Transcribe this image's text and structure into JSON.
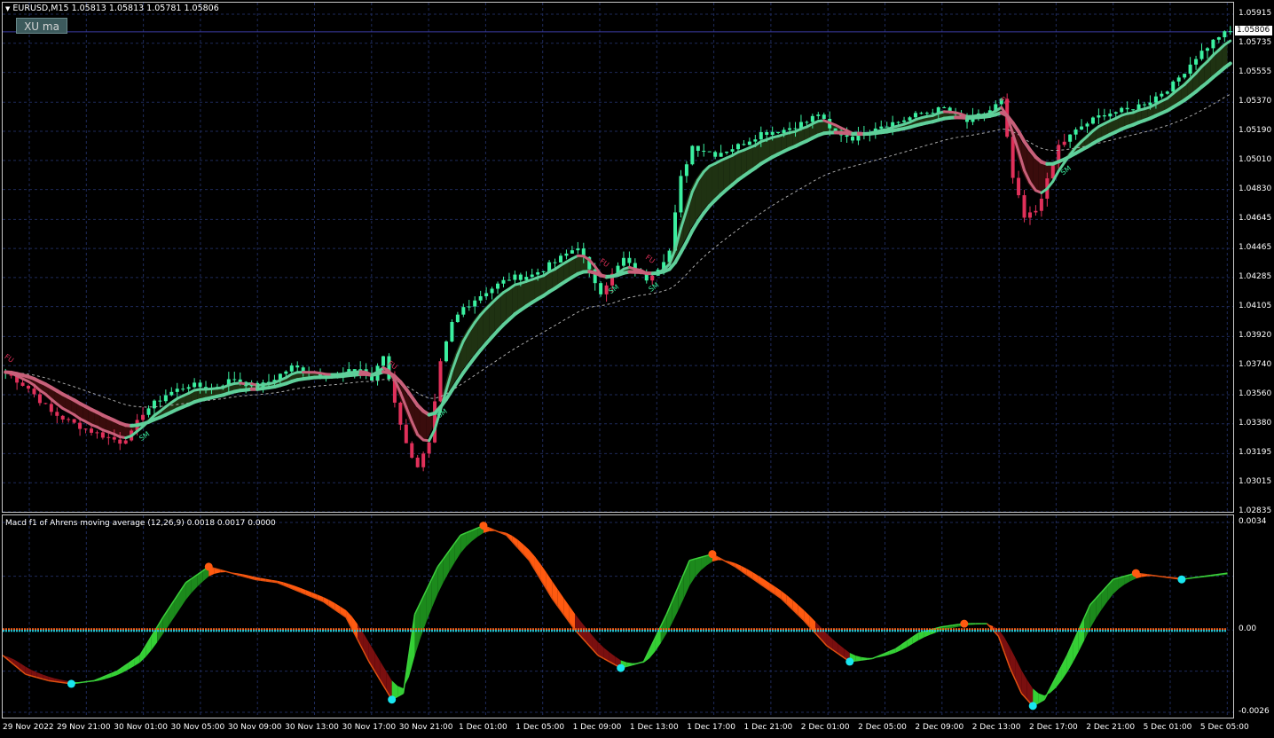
{
  "header": {
    "symbol_line": "EURUSD,M15  1.05813 1.05813 1.05781 1.05806",
    "indicator_button": "XU ma",
    "current_price": "1.05806"
  },
  "main_axis": {
    "labels": [
      "1.05915",
      "1.05735",
      "1.05555",
      "1.05370",
      "1.05190",
      "1.05010",
      "1.04830",
      "1.04645",
      "1.04465",
      "1.04285",
      "1.04105",
      "1.03920",
      "1.03740",
      "1.03560",
      "1.03380",
      "1.03195",
      "1.03015",
      "1.02835"
    ]
  },
  "sub_window": {
    "title": "Macd f1 of Ahrens moving average (12,26,9) 0.0018 0.0017 0.0000",
    "axis_labels": [
      "0.0034",
      "0.00",
      "-0.0026"
    ]
  },
  "time_axis": {
    "labels": [
      "29 Nov 2022",
      "29 Nov 21:00",
      "30 Nov 01:00",
      "30 Nov 05:00",
      "30 Nov 09:00",
      "30 Nov 13:00",
      "30 Nov 17:00",
      "30 Nov 21:00",
      "1 Dec 01:00",
      "1 Dec 05:00",
      "1 Dec 09:00",
      "1 Dec 13:00",
      "1 Dec 17:00",
      "1 Dec 21:00",
      "2 Dec 01:00",
      "2 Dec 05:00",
      "2 Dec 09:00",
      "2 Dec 13:00",
      "2 Dec 17:00",
      "2 Dec 21:00",
      "5 Dec 01:00",
      "5 Dec 05:00"
    ]
  },
  "signals": {
    "down_label": "FU",
    "up_label": "SM"
  },
  "chart_data": {
    "type": "line",
    "symbol": "EURUSD",
    "timeframe": "M15",
    "ohlc_last": {
      "open": 1.05813,
      "high": 1.05813,
      "low": 1.05781,
      "close": 1.05806
    },
    "price_range": [
      1.02835,
      1.05915
    ],
    "close_path": [
      [
        0,
        1.037
      ],
      [
        4,
        1.036
      ],
      [
        8,
        1.0345
      ],
      [
        12,
        1.0338
      ],
      [
        16,
        1.0332
      ],
      [
        20,
        1.0327
      ],
      [
        22,
        1.0332
      ],
      [
        24,
        1.0345
      ],
      [
        28,
        1.0356
      ],
      [
        32,
        1.0362
      ],
      [
        36,
        1.036
      ],
      [
        40,
        1.0366
      ],
      [
        44,
        1.036
      ],
      [
        46,
        1.0364
      ],
      [
        50,
        1.0373
      ],
      [
        54,
        1.037
      ],
      [
        58,
        1.0368
      ],
      [
        62,
        1.0372
      ],
      [
        64,
        1.0365
      ],
      [
        66,
        1.038
      ],
      [
        68,
        1.0352
      ],
      [
        70,
        1.0325
      ],
      [
        72,
        1.0312
      ],
      [
        74,
        1.0325
      ],
      [
        75,
        1.035
      ],
      [
        76,
        1.0375
      ],
      [
        78,
        1.04
      ],
      [
        80,
        1.041
      ],
      [
        84,
        1.042
      ],
      [
        88,
        1.0428
      ],
      [
        92,
        1.043
      ],
      [
        96,
        1.0438
      ],
      [
        100,
        1.0448
      ],
      [
        102,
        1.0432
      ],
      [
        104,
        1.042
      ],
      [
        106,
        1.043
      ],
      [
        108,
        1.044
      ],
      [
        110,
        1.0432
      ],
      [
        112,
        1.0428
      ],
      [
        114,
        1.0435
      ],
      [
        116,
        1.0445
      ],
      [
        118,
        1.049
      ],
      [
        120,
        1.051
      ],
      [
        124,
        1.0505
      ],
      [
        128,
        1.051
      ],
      [
        132,
        1.0518
      ],
      [
        136,
        1.052
      ],
      [
        140,
        1.0525
      ],
      [
        142,
        1.053
      ],
      [
        144,
        1.052
      ],
      [
        148,
        1.0515
      ],
      [
        152,
        1.0522
      ],
      [
        156,
        1.0525
      ],
      [
        160,
        1.053
      ],
      [
        164,
        1.0533
      ],
      [
        166,
        1.0528
      ],
      [
        168,
        1.0525
      ],
      [
        172,
        1.0532
      ],
      [
        174,
        1.0538
      ],
      [
        176,
        1.049
      ],
      [
        178,
        1.0465
      ],
      [
        180,
        1.047
      ],
      [
        182,
        1.0488
      ],
      [
        184,
        1.051
      ],
      [
        188,
        1.0522
      ],
      [
        192,
        1.053
      ],
      [
        196,
        1.0532
      ],
      [
        200,
        1.0538
      ],
      [
        204,
        1.0548
      ],
      [
        208,
        1.0565
      ],
      [
        212,
        1.0578
      ],
      [
        214,
        1.05806
      ]
    ],
    "macd_path": [
      [
        0,
        -0.0008
      ],
      [
        4,
        -0.0014
      ],
      [
        8,
        -0.0016
      ],
      [
        12,
        -0.0017
      ],
      [
        16,
        -0.0016
      ],
      [
        20,
        -0.0013
      ],
      [
        24,
        -0.0008
      ],
      [
        28,
        0.0004
      ],
      [
        32,
        0.0015
      ],
      [
        36,
        0.002
      ],
      [
        40,
        0.0018
      ],
      [
        44,
        0.0016
      ],
      [
        48,
        0.0015
      ],
      [
        52,
        0.0012
      ],
      [
        56,
        0.0009
      ],
      [
        60,
        0.0004
      ],
      [
        64,
        -0.001
      ],
      [
        68,
        -0.0022
      ],
      [
        70,
        -0.002
      ],
      [
        72,
        0.0005
      ],
      [
        76,
        0.002
      ],
      [
        80,
        0.003
      ],
      [
        84,
        0.0033
      ],
      [
        88,
        0.003
      ],
      [
        92,
        0.0022
      ],
      [
        96,
        0.001
      ],
      [
        100,
        0.0
      ],
      [
        104,
        -0.0008
      ],
      [
        108,
        -0.0012
      ],
      [
        112,
        -0.001
      ],
      [
        116,
        0.0005
      ],
      [
        120,
        0.0022
      ],
      [
        124,
        0.0024
      ],
      [
        128,
        0.002
      ],
      [
        132,
        0.0015
      ],
      [
        136,
        0.001
      ],
      [
        140,
        0.0003
      ],
      [
        144,
        -0.0005
      ],
      [
        148,
        -0.001
      ],
      [
        152,
        -0.0009
      ],
      [
        156,
        -0.0006
      ],
      [
        160,
        -0.0001
      ],
      [
        164,
        0.0001
      ],
      [
        168,
        0.0002
      ],
      [
        172,
        0.0002
      ],
      [
        174,
        -0.0002
      ],
      [
        176,
        -0.0012
      ],
      [
        178,
        -0.002
      ],
      [
        180,
        -0.0024
      ],
      [
        182,
        -0.0022
      ],
      [
        186,
        -0.0008
      ],
      [
        190,
        0.0008
      ],
      [
        194,
        0.0016
      ],
      [
        198,
        0.0018
      ],
      [
        202,
        0.0017
      ],
      [
        206,
        0.0016
      ],
      [
        210,
        0.0017
      ],
      [
        214,
        0.0018
      ]
    ],
    "macd_range": [
      -0.0026,
      0.0034
    ],
    "zero_level": 0.0
  }
}
